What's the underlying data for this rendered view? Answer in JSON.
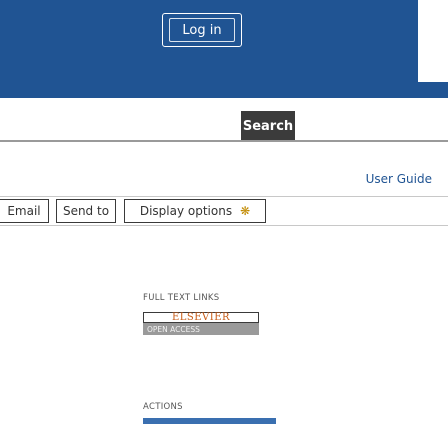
{
  "header": {
    "login_label": "Log in"
  },
  "search": {
    "button_label": "Search",
    "placeholder": ""
  },
  "links": {
    "user_guide": "User Guide"
  },
  "toolbar": {
    "email_label": "Email",
    "send_to_label": "Send to",
    "display_options_label": "Display options",
    "display_options_icon": "gear-icon"
  },
  "full_text": {
    "heading": "FULL TEXT LINKS",
    "publisher_name": "ELSEVIER",
    "access_label": "OPEN ACCESS"
  },
  "actions": {
    "heading": "ACTIONS"
  },
  "colors": {
    "header_blue": "#205493",
    "link_blue": "#205493",
    "search_button": "#3b3b3b",
    "elsevier_orange": "#c85a14",
    "gear_gold": "#c28a00"
  }
}
